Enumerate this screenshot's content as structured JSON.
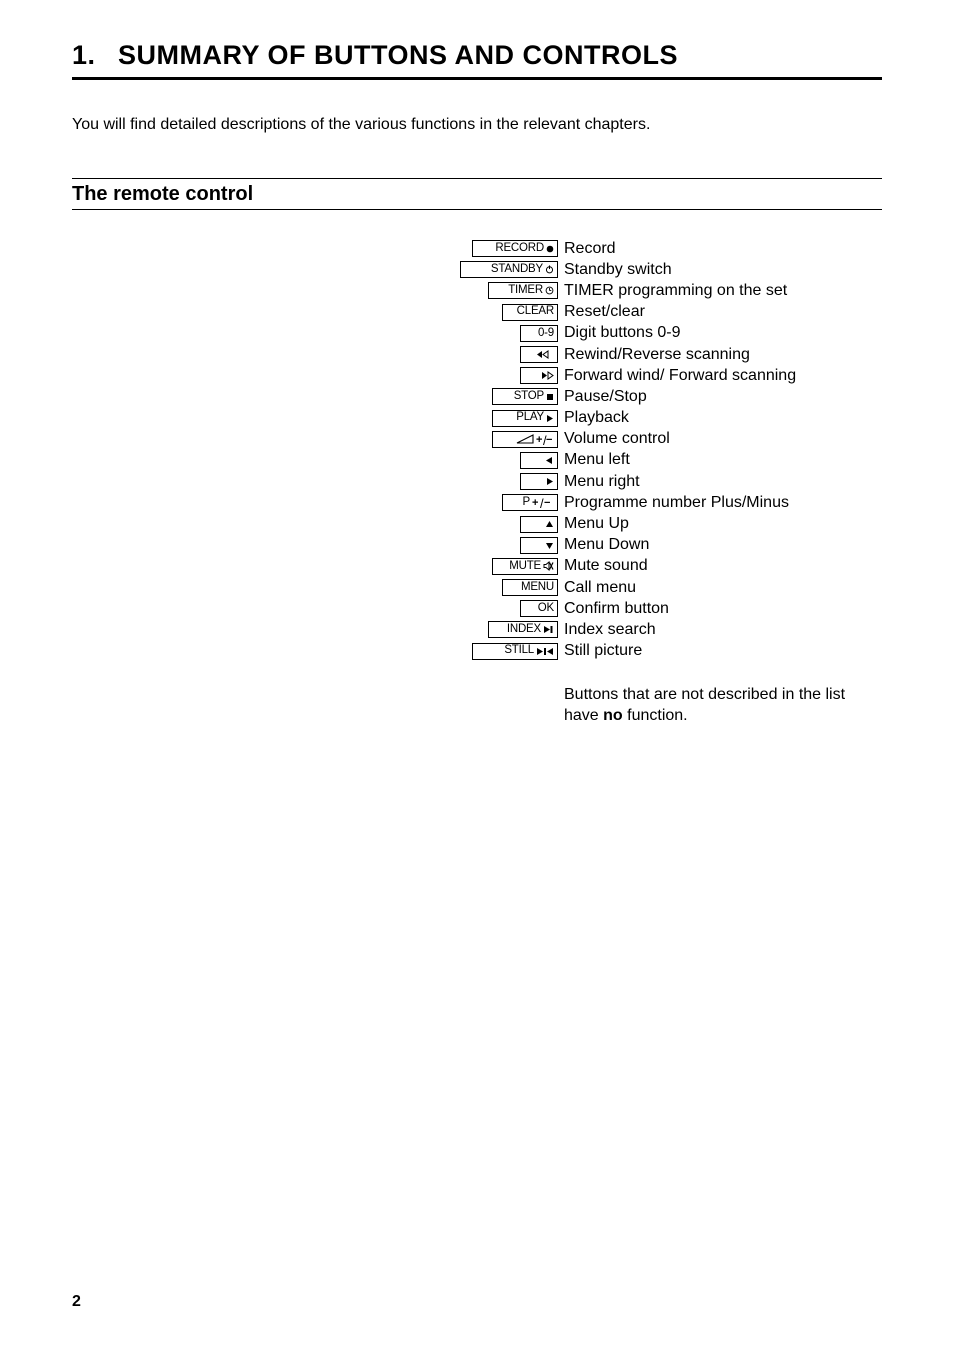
{
  "chapter": {
    "number": "1.",
    "title": "SUMMARY OF BUTTONS AND CONTROLS"
  },
  "intro": "You will find detailed descriptions of the various functions in the relevant chapters.",
  "section": {
    "title": "The remote control"
  },
  "buttons": {
    "record": {
      "label": "RECORD",
      "desc": "Record"
    },
    "standby": {
      "label": "STANDBY",
      "desc": "Standby switch"
    },
    "timer": {
      "label": "TIMER",
      "desc": "TIMER programming on the set"
    },
    "clear": {
      "label": "CLEAR",
      "desc": "Reset/clear"
    },
    "digits": {
      "label": "0-9",
      "desc": "Digit buttons 0-9"
    },
    "rew": {
      "label": "",
      "desc": "Rewind/Reverse scanning"
    },
    "ffwd": {
      "label": "",
      "desc": "Forward wind/ Forward scanning"
    },
    "stop": {
      "label": "STOP",
      "desc": "Pause/Stop"
    },
    "play": {
      "label": "PLAY",
      "desc": "Playback"
    },
    "vol": {
      "label": "",
      "desc": "Volume control"
    },
    "mleft": {
      "label": "",
      "desc": "Menu left"
    },
    "mright": {
      "label": "",
      "desc": "Menu right"
    },
    "prog": {
      "label": "P",
      "desc": "Programme number Plus/Minus"
    },
    "mup": {
      "label": "",
      "desc": "Menu Up"
    },
    "mdown": {
      "label": "",
      "desc": "Menu Down"
    },
    "mute": {
      "label": "MUTE",
      "desc": "Mute sound"
    },
    "menu": {
      "label": "MENU",
      "desc": "Call menu"
    },
    "ok": {
      "label": "OK",
      "desc": "Confirm button"
    },
    "index": {
      "label": "INDEX",
      "desc": "Index search"
    },
    "still": {
      "label": "STILL",
      "desc": "Still picture"
    }
  },
  "footnote": {
    "pre": "Buttons that are not described in the list have ",
    "bold": "no",
    "post": " function."
  },
  "pagenum": "2"
}
